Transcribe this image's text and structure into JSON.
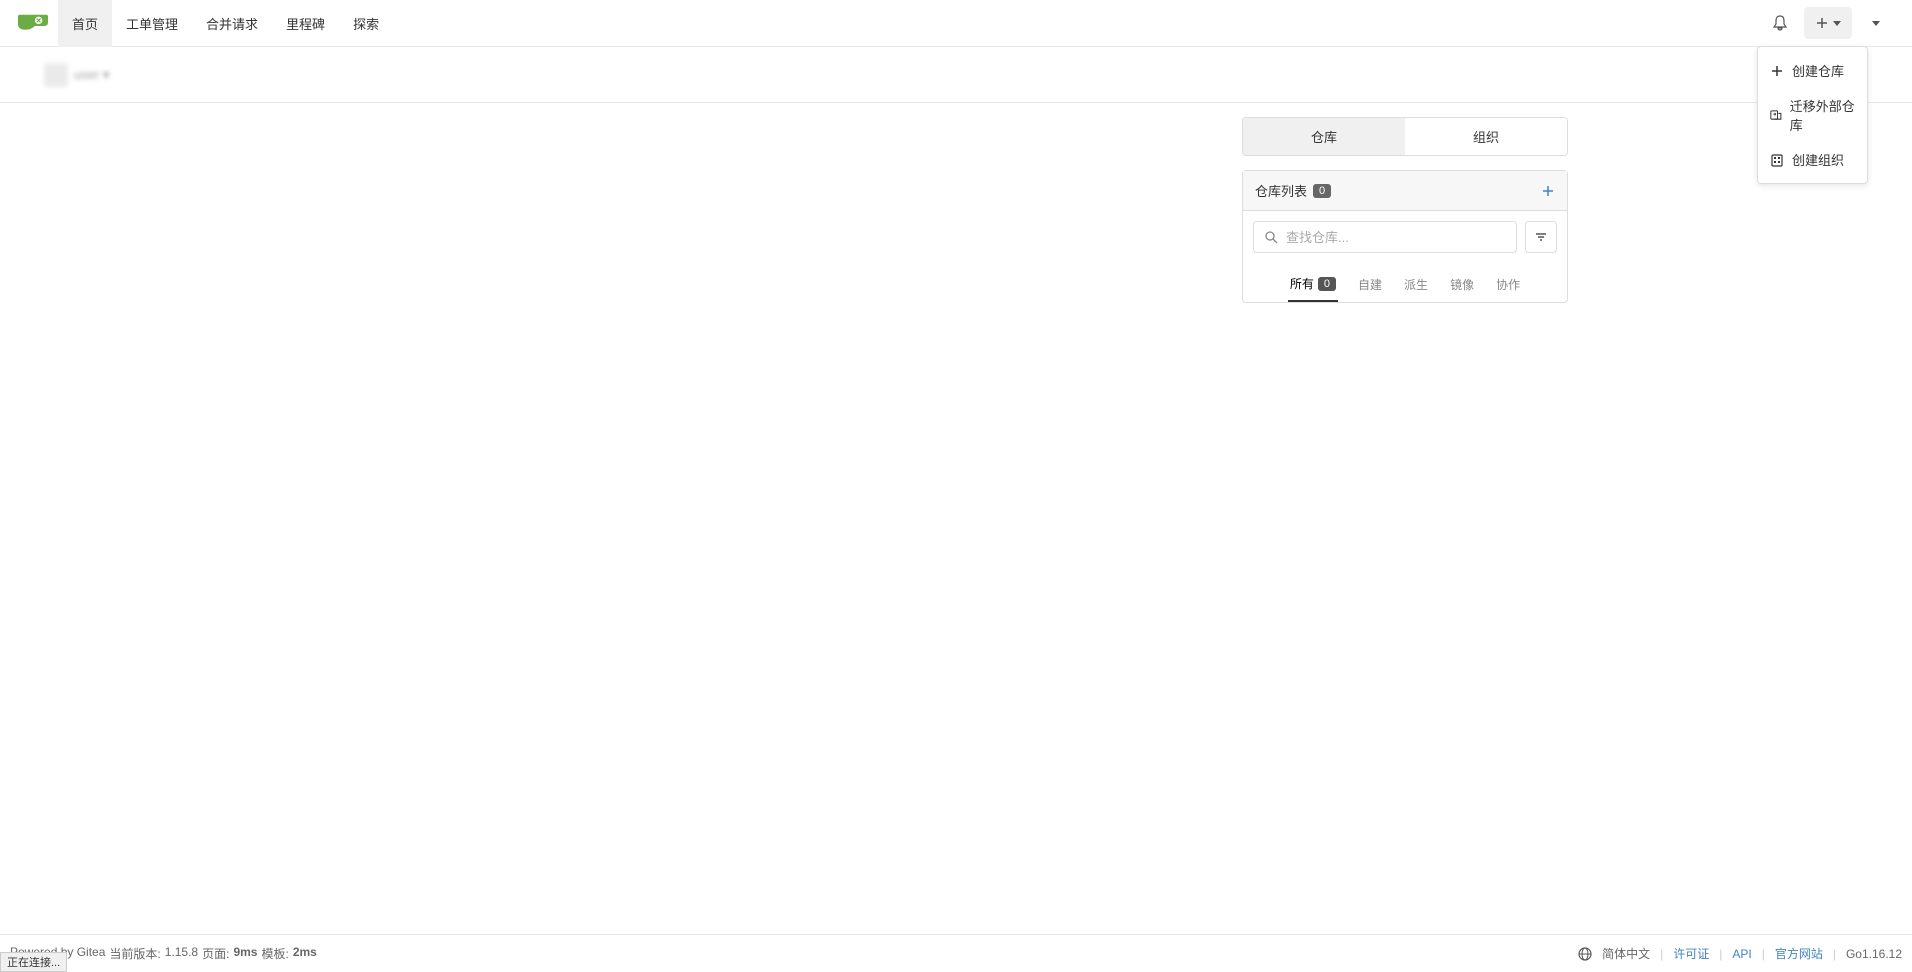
{
  "nav": {
    "items": [
      "首页",
      "工单管理",
      "合并请求",
      "里程碑",
      "探索"
    ],
    "active_index": 0
  },
  "dropdown": {
    "items": [
      {
        "icon": "plus",
        "label": "创建仓库"
      },
      {
        "icon": "migrate",
        "label": "迁移外部仓库"
      },
      {
        "icon": "org",
        "label": "创建组织"
      }
    ]
  },
  "user": {
    "name": "user ▾"
  },
  "right_panel": {
    "tabs": [
      "仓库",
      "组织"
    ],
    "active_tab": 0,
    "title": "仓库列表",
    "count": "0",
    "search_placeholder": "查找仓库...",
    "sub_tabs": [
      {
        "label": "所有",
        "count": "0"
      },
      {
        "label": "自建"
      },
      {
        "label": "派生"
      },
      {
        "label": "镜像"
      },
      {
        "label": "协作"
      }
    ],
    "active_sub_tab": 0
  },
  "footer": {
    "powered": "Powered by Gitea",
    "version_label": "当前版本:",
    "version": "1.15.8",
    "page_label": "页面:",
    "page_time": "9ms",
    "tmpl_label": "模板:",
    "tmpl_time": "2ms",
    "lang": "简体中文",
    "license": "许可证",
    "api": "API",
    "website": "官方网站",
    "go": "Go1.16.12"
  },
  "status": "正在连接..."
}
